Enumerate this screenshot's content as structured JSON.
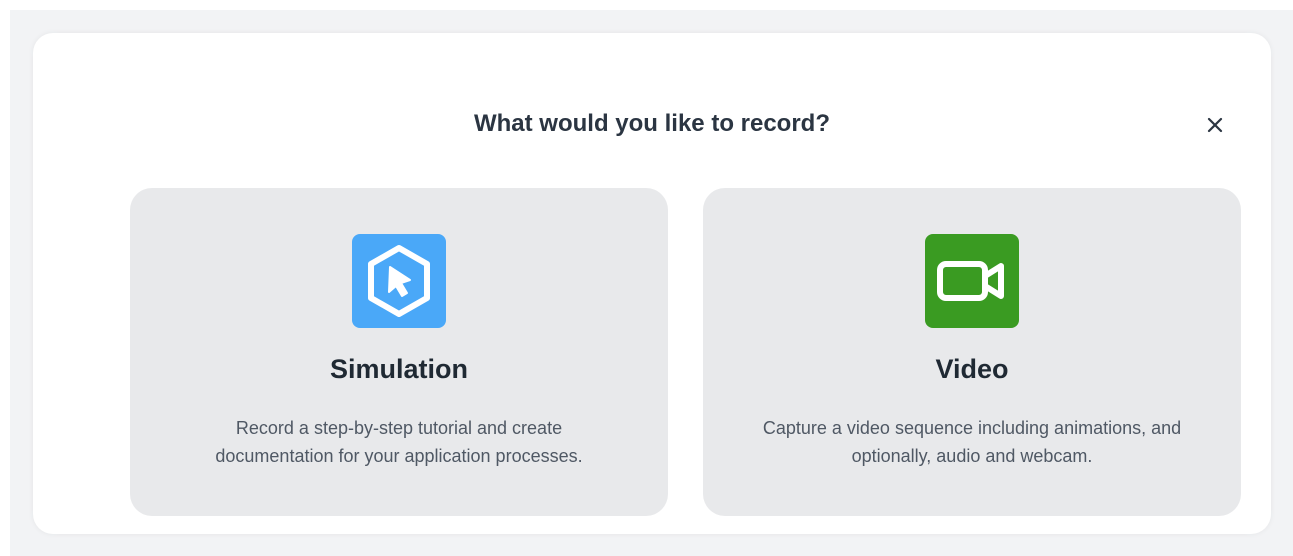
{
  "dialog": {
    "title": "What would you like to record?",
    "close_icon": "close-icon"
  },
  "options": [
    {
      "title": "Simulation",
      "description_lines": [
        "Record a step-by-step tutorial and create",
        "documentation for your application processes."
      ],
      "icon": "simulation-cursor-icon",
      "icon_color": "#4aa8f8"
    },
    {
      "title": "Video",
      "description_lines": [
        "Capture a video sequence including animations, and",
        "optionally, audio and webcam."
      ],
      "icon": "video-camera-icon",
      "icon_color": "#3a9b22"
    }
  ]
}
